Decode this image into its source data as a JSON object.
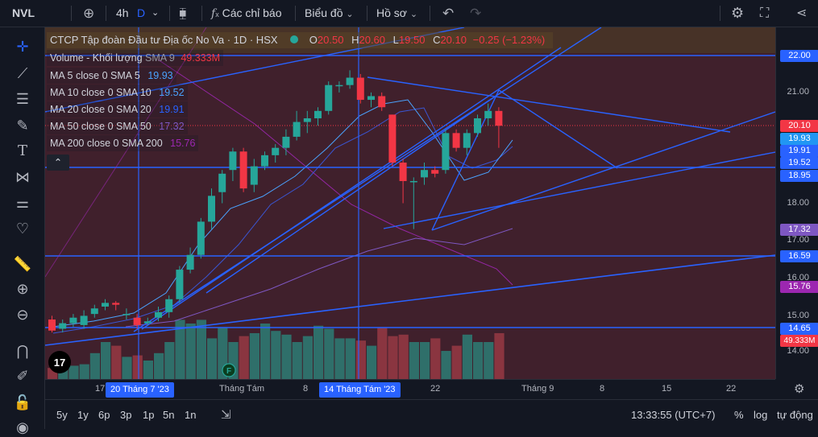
{
  "topbar": {
    "symbol": "NVL",
    "interval": "4h",
    "interval_short": "D",
    "indicators": "Các chỉ báo",
    "chart": "Biểu đồ",
    "profile": "Hồ sơ"
  },
  "legend": {
    "title": "CTCP Tập đoàn Đầu tư Địa ốc No Va · 1D · HSX",
    "ohlc_o_label": "O",
    "ohlc_o": "20.50",
    "ohlc_h_label": "H",
    "ohlc_h": "20.60",
    "ohlc_l_label": "L",
    "ohlc_l": "19.50",
    "ohlc_c_label": "C",
    "ohlc_c": "20.10",
    "change": "−0.25 (−1.23%)",
    "volume_label": "Volume - Khối lượng",
    "volume_sma": "SMA 9",
    "volume_value": "49.333M",
    "ma": [
      {
        "label": "MA 5 close 0 SMA 5",
        "value": "19.93",
        "color": "#4aa3ff"
      },
      {
        "label": "MA 10 close 0 SMA 10",
        "value": "19.52",
        "color": "#4aa3ff"
      },
      {
        "label": "MA 20 close 0 SMA 20",
        "value": "19.91",
        "color": "#2962ff"
      },
      {
        "label": "MA 50 close 0 SMA 50",
        "value": "17.32",
        "color": "#7e57c2"
      },
      {
        "label": "MA 200 close 0 SMA 200",
        "value": "15.76",
        "color": "#9c27b0"
      }
    ]
  },
  "price_axis": {
    "ticks": [
      "21.00",
      "18.00",
      "17.00",
      "16.00",
      "15.00",
      "14.00"
    ],
    "labels": [
      {
        "text": "22.00",
        "color": "#2962ff"
      },
      {
        "text": "20.10",
        "color": "#f23645"
      },
      {
        "text": "19.93",
        "color": "#2196f3"
      },
      {
        "text": "19.91",
        "color": "#2962ff"
      },
      {
        "text": "19.52",
        "color": "#2962ff"
      },
      {
        "text": "18.95",
        "color": "#2962ff"
      },
      {
        "text": "17.32",
        "color": "#7e57c2"
      },
      {
        "text": "16.59",
        "color": "#2962ff"
      },
      {
        "text": "15.76",
        "color": "#9c27b0"
      },
      {
        "text": "14.65",
        "color": "#2962ff"
      },
      {
        "text": "49.333M",
        "color": "#f23645"
      }
    ]
  },
  "time_axis": {
    "ticks": [
      "17",
      "Tháng Tám",
      "8",
      "22",
      "Tháng 9",
      "8",
      "15",
      "22"
    ],
    "crosshair_labels": [
      "20 Tháng 7 '23",
      "14 Tháng Tám '23"
    ]
  },
  "bottombar": {
    "ranges": [
      "5y",
      "1y",
      "6p",
      "3p",
      "1p",
      "5n",
      "1n"
    ],
    "clock": "13:33:55 (UTC+7)",
    "percent": "%",
    "log": "log",
    "auto": "tự động"
  },
  "colors": {
    "up": "#26a69a",
    "down": "#f23645",
    "line": "#2962ff",
    "background": "#131722",
    "chart_tint": "#40202c"
  }
}
